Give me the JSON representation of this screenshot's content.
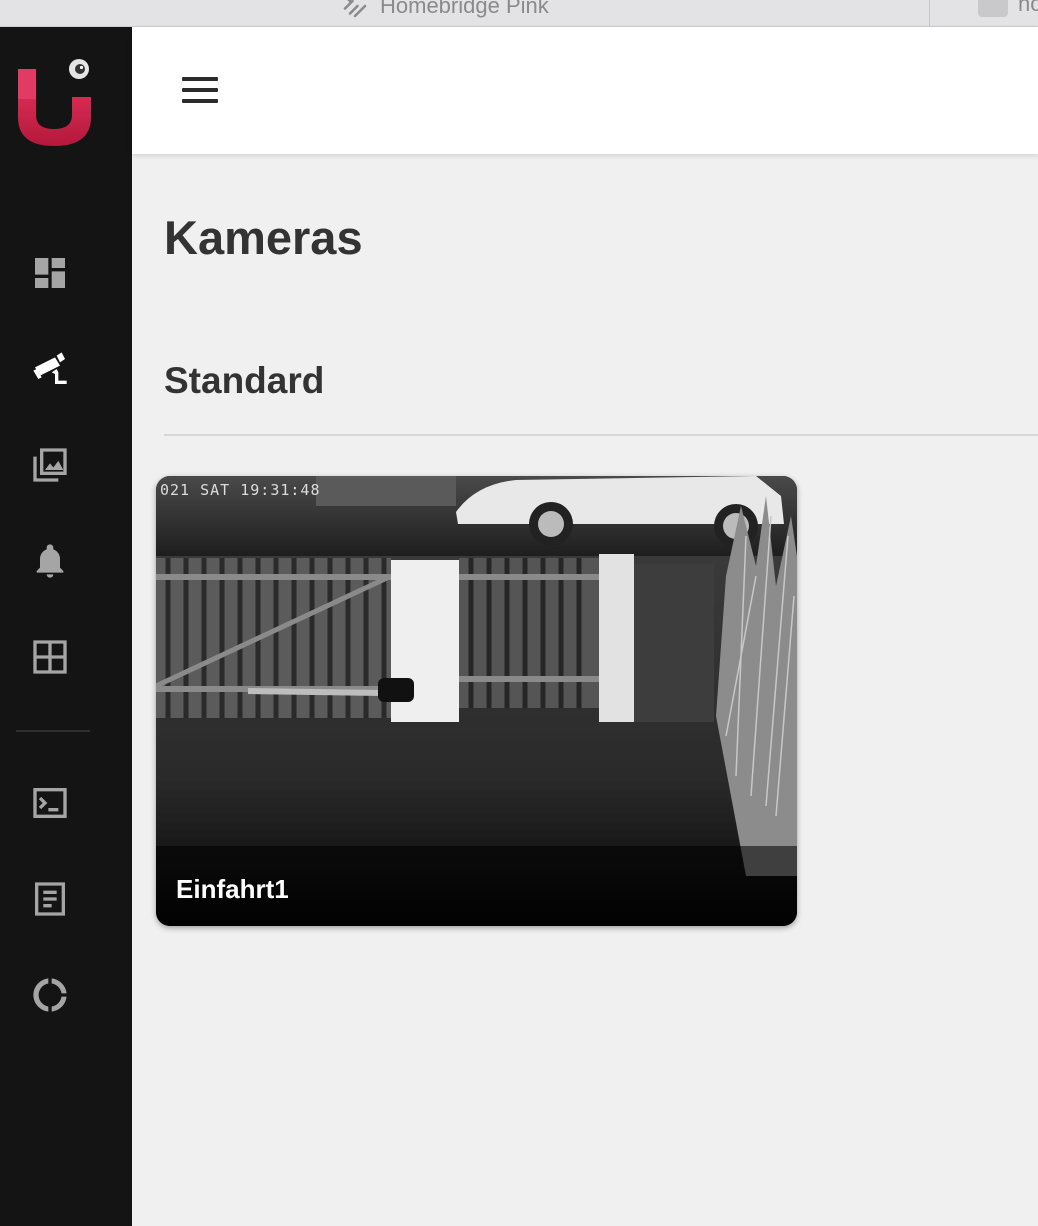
{
  "browser": {
    "tab_title": "Homebridge Pink",
    "tab2_title": "ho"
  },
  "sidebar": {
    "logo_icon": "camera-ui-logo",
    "accent_color": "#e0284e",
    "items": [
      {
        "name": "dashboard",
        "icon": "dashboard-icon",
        "active": false
      },
      {
        "name": "cameras",
        "icon": "cctv-camera-icon",
        "active": true
      },
      {
        "name": "recordings",
        "icon": "photo-library-icon",
        "active": false
      },
      {
        "name": "notifications",
        "icon": "bell-icon",
        "active": false
      },
      {
        "name": "camview",
        "icon": "grid-icon",
        "active": false
      },
      {
        "name": "console",
        "icon": "terminal-icon",
        "active": false
      },
      {
        "name": "log",
        "icon": "document-icon",
        "active": false
      },
      {
        "name": "utilization",
        "icon": "donut-chart-icon",
        "active": false
      }
    ]
  },
  "header": {
    "menu_icon": "hamburger-menu-icon"
  },
  "main": {
    "title": "Kameras",
    "sections": [
      {
        "title": "Standard",
        "cameras": [
          {
            "name": "Einfahrt1",
            "overlay_timestamp": "021 SAT 19:31:48"
          }
        ]
      }
    ]
  }
}
